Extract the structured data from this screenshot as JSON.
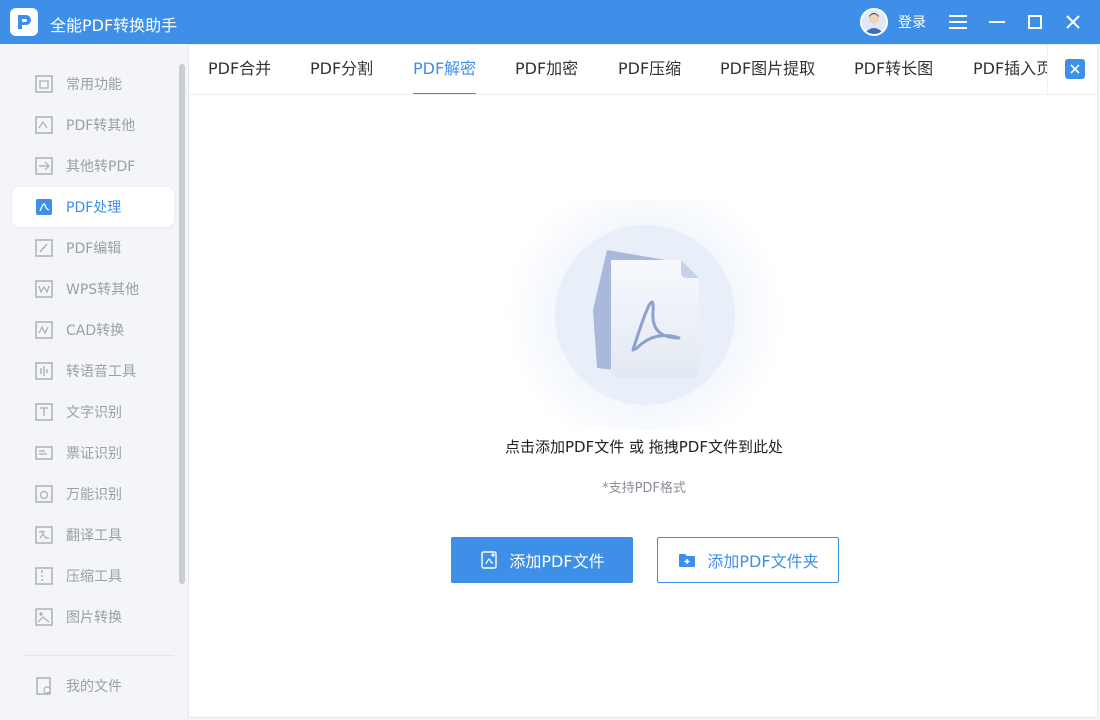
{
  "app": {
    "title": "全能PDF转换助手",
    "login_label": "登录",
    "accent": "#3d8fe8"
  },
  "sidebar": {
    "items": [
      {
        "label": "常用功能",
        "icon": "home-grid-icon"
      },
      {
        "label": "PDF转其他",
        "icon": "pdf-convert-icon"
      },
      {
        "label": "其他转PDF",
        "icon": "to-pdf-icon"
      },
      {
        "label": "PDF处理",
        "icon": "pdf-process-icon",
        "active": true
      },
      {
        "label": "PDF编辑",
        "icon": "pdf-edit-icon"
      },
      {
        "label": "WPS转其他",
        "icon": "wps-icon"
      },
      {
        "label": "CAD转换",
        "icon": "cad-icon"
      },
      {
        "label": "转语音工具",
        "icon": "voice-icon"
      },
      {
        "label": "文字识别",
        "icon": "text-ocr-icon"
      },
      {
        "label": "票证识别",
        "icon": "ticket-ocr-icon"
      },
      {
        "label": "万能识别",
        "icon": "universal-ocr-icon"
      },
      {
        "label": "翻译工具",
        "icon": "translate-icon"
      },
      {
        "label": "压缩工具",
        "icon": "compress-icon"
      },
      {
        "label": "图片转换",
        "icon": "image-convert-icon"
      }
    ],
    "my_files": {
      "label": "我的文件",
      "icon": "my-files-icon"
    }
  },
  "tabs": [
    {
      "label": "PDF合并"
    },
    {
      "label": "PDF分割"
    },
    {
      "label": "PDF解密",
      "active": true
    },
    {
      "label": "PDF加密"
    },
    {
      "label": "PDF压缩"
    },
    {
      "label": "PDF图片提取"
    },
    {
      "label": "PDF转长图"
    },
    {
      "label": "PDF插入页"
    }
  ],
  "dropzone": {
    "main_text": "点击添加PDF文件 或 拖拽PDF文件到此处",
    "hint_text": "*支持PDF格式",
    "add_file_label": "添加PDF文件",
    "add_folder_label": "添加PDF文件夹"
  }
}
